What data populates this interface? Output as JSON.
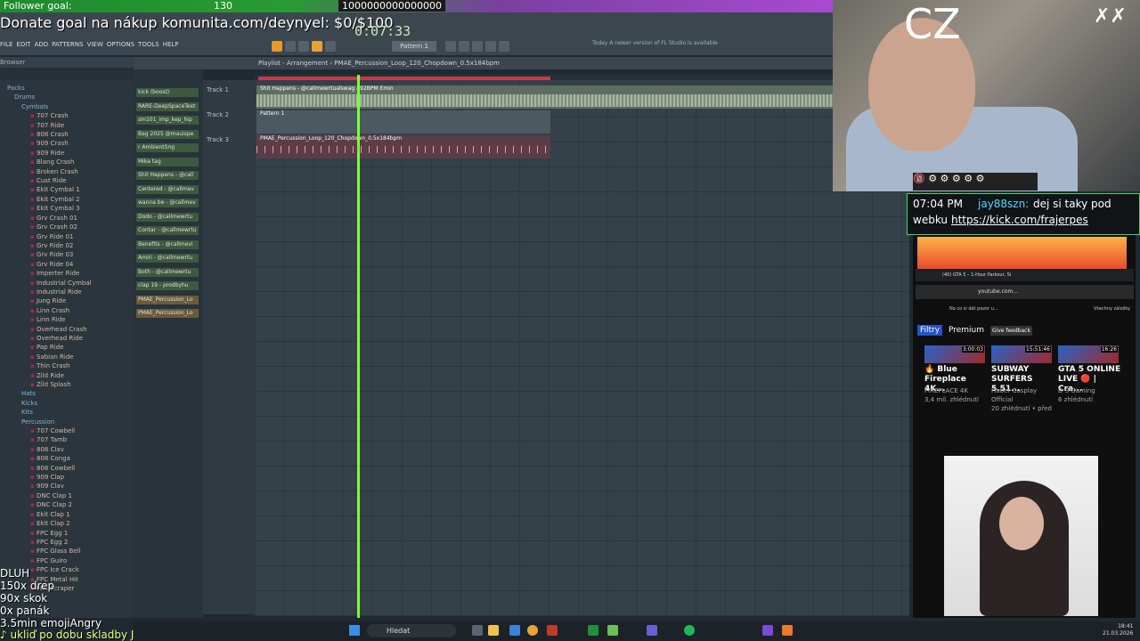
{
  "stream": {
    "goal_label": "Follower goal:",
    "goal_count": "130",
    "goal_target": "1000000000000000",
    "donate": "Donate goal na nákup komunita.com/deynyel: $0/$100",
    "overlay_lines": [
      "DLUH",
      "150x drep",
      "90x skok",
      "0x panák",
      "3.5min emojiAngry"
    ],
    "now_playing": "♪ ukliď po dobu skladby Jarda Kovář Hoodtrap",
    "webcam_text": "CZ"
  },
  "fl": {
    "menu": [
      "FILE",
      "EDIT",
      "ADD",
      "PATTERNS",
      "VIEW",
      "OPTIONS",
      "TOOLS",
      "HELP"
    ],
    "time": "0:07:33",
    "pattern": "Pattern 1",
    "news": "Today  A newer version of FL Studio is available",
    "playlist_title": "Playlist - Arrangement  ›  PMAE_Percussion_Loop_120_Chopdown_0.5x184bpm",
    "browser_title": "Browser",
    "track_labels": [
      "Track 1",
      "Track 2",
      "Track 3"
    ],
    "clip1": "Shit Happens - @callmewrtualswag - 92BPM Emin",
    "clip2": "Pattern 1",
    "clip3": "PMAE_Percussion_Loop_120_Chopdown_0.5x184bpm",
    "picker": [
      "kick (boost)",
      "RARE-DeepSpaceText",
      "sm101_imp_kep_hip",
      "Bag 2025 @mauispe",
      "r AmbientSng",
      "Mika tag",
      "Shit Happens - @call",
      "Centered - @callmev",
      "wanna be - @callmev",
      "Dodo - @callmewrtu",
      "Contar - @callmewrtu",
      "Benefits - @callmevi",
      "Amiri - @callmewrtu",
      "Both - @callmewrtu",
      "clap 19 - prodbyhu",
      "PMAE_Percussion_Lo",
      "PMAE_Percussion_Lo"
    ],
    "tree": [
      {
        "type": "fold",
        "label": "Packs",
        "indent": 8
      },
      {
        "type": "fold",
        "label": "Drums",
        "indent": 16
      },
      {
        "type": "fold",
        "label": "Cymbals",
        "indent": 24
      },
      {
        "type": "item",
        "label": "707 Crash"
      },
      {
        "type": "item",
        "label": "707 Ride"
      },
      {
        "type": "item",
        "label": "808 Crash"
      },
      {
        "type": "item",
        "label": "909 Crash"
      },
      {
        "type": "item",
        "label": "909 Ride"
      },
      {
        "type": "item",
        "label": "Blang Crash"
      },
      {
        "type": "item",
        "label": "Broken Crash"
      },
      {
        "type": "item",
        "label": "Cust Ride"
      },
      {
        "type": "item",
        "label": "Ekit Cymbal 1"
      },
      {
        "type": "item",
        "label": "Ekit Cymbal 2"
      },
      {
        "type": "item",
        "label": "Ekit Cymbal 3"
      },
      {
        "type": "item",
        "label": "Grv Crash 01"
      },
      {
        "type": "item",
        "label": "Grv Crash 02"
      },
      {
        "type": "item",
        "label": "Grv Ride 01"
      },
      {
        "type": "item",
        "label": "Grv Ride 02"
      },
      {
        "type": "item",
        "label": "Grv Ride 03"
      },
      {
        "type": "item",
        "label": "Grv Ride 04"
      },
      {
        "type": "item",
        "label": "Imperter Ride"
      },
      {
        "type": "item",
        "label": "Industrial Cymbal"
      },
      {
        "type": "item",
        "label": "Industrial Ride"
      },
      {
        "type": "item",
        "label": "Jung Ride"
      },
      {
        "type": "item",
        "label": "Linn Crash"
      },
      {
        "type": "item",
        "label": "Linn Ride"
      },
      {
        "type": "item",
        "label": "Overhead Crash"
      },
      {
        "type": "item",
        "label": "Overhead Ride"
      },
      {
        "type": "item",
        "label": "Pap Ride"
      },
      {
        "type": "item",
        "label": "Sabian Ride"
      },
      {
        "type": "item",
        "label": "Thin Crash"
      },
      {
        "type": "item",
        "label": "Zild Ride"
      },
      {
        "type": "item",
        "label": "Zild Splash"
      },
      {
        "type": "fold",
        "label": "Hats",
        "indent": 24
      },
      {
        "type": "fold",
        "label": "Kicks",
        "indent": 24
      },
      {
        "type": "fold",
        "label": "Kits",
        "indent": 24
      },
      {
        "type": "fold",
        "label": "Percussion",
        "indent": 24
      },
      {
        "type": "item",
        "label": "707 Cowbell"
      },
      {
        "type": "item",
        "label": "707 Tamb"
      },
      {
        "type": "item",
        "label": "808 Clav"
      },
      {
        "type": "item",
        "label": "808 Conga"
      },
      {
        "type": "item",
        "label": "808 Cowbell"
      },
      {
        "type": "item",
        "label": "909 Clap"
      },
      {
        "type": "item",
        "label": "909 Clav"
      },
      {
        "type": "item",
        "label": "DNC Clap 1"
      },
      {
        "type": "item",
        "label": "DNC Clap 2"
      },
      {
        "type": "item",
        "label": "Ekit Clap 1"
      },
      {
        "type": "item",
        "label": "Ekit Clap 2"
      },
      {
        "type": "item",
        "label": "FPC Egg 1"
      },
      {
        "type": "item",
        "label": "FPC Egg 2"
      },
      {
        "type": "item",
        "label": "FPC Glass Bell"
      },
      {
        "type": "item",
        "label": "FPC Guiro"
      },
      {
        "type": "item",
        "label": "FPC Ice Crack"
      },
      {
        "type": "item",
        "label": "FPC Metal Hit"
      },
      {
        "type": "item",
        "label": "FPC Scraper"
      }
    ]
  },
  "chat": {
    "time": "07:04 PM",
    "user": "jay88szn:",
    "msg": "dej si taky pod",
    "msg2": "webku",
    "link": "https://kick.com/frajerpes"
  },
  "youtube": {
    "tab": "(40) GTA 5 – 1-Hour Parkour, Si",
    "address": "youtube.com...",
    "bookmarks": "Na co si dát pozor u...",
    "bookmarks_right": "Všechny záložky",
    "chips": [
      "Filtry",
      "Premium",
      "Give feedback"
    ],
    "videos": [
      {
        "duration": "3:00:03",
        "title": "🔥 Blue Fireplace 4K...",
        "channel": "FIREPLACE 4K",
        "meta": "3,4 mil. zhlédnutí"
      },
      {
        "duration": "15:51:46",
        "title": "SUBWAY SURFERS 5.51...",
        "channel": "ITuber Cosplay Official",
        "meta": "20 zhlédnutí • před"
      },
      {
        "duration": "16:26",
        "title": "GTA 5 ONLINE LIVE 🔴 | Cra...",
        "channel": "D S Gaming",
        "meta": "6 zhlédnutí"
      }
    ]
  },
  "taskbar": {
    "search": "Hledat",
    "time": "18:41",
    "date": "21.03.2026"
  }
}
